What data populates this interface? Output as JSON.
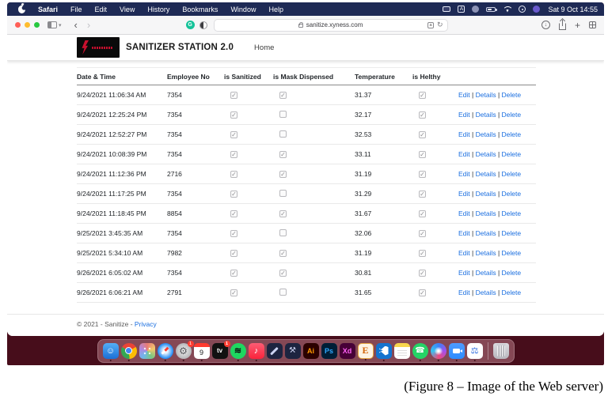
{
  "colors": {
    "menubar": "#1e2a55",
    "wallpaper": "#470d1b",
    "link": "#1b6fe0",
    "brand_red": "#c8102e",
    "badge_red": "#ff3b30"
  },
  "menu_bar": {
    "items": [
      "Safari",
      "File",
      "Edit",
      "View",
      "History",
      "Bookmarks",
      "Window",
      "Help"
    ],
    "status_icons": [
      {
        "key": "screen-mirroring"
      },
      {
        "key": "input-source",
        "glyph": "A"
      },
      {
        "key": "status-circle"
      },
      {
        "key": "battery"
      },
      {
        "key": "wifi"
      },
      {
        "key": "control-center"
      },
      {
        "key": "purple-dot"
      }
    ],
    "clock": "Sat 9 Oct 14:55"
  },
  "browser": {
    "url": "sanitize.xyness.com"
  },
  "site": {
    "title": "SANITIZER STATION 2.0",
    "nav_home": "Home",
    "footer_copyright": "© 2021 - Sanitize -",
    "footer_privacy": "Privacy"
  },
  "table": {
    "columns": [
      "Date & Time",
      "Employee No",
      "is Sanitized",
      "is Mask Dispensed",
      "Temperature",
      "is Helthy"
    ],
    "actions": {
      "edit": "Edit",
      "details": "Details",
      "delete": "Delete",
      "separator": " | "
    },
    "rows": [
      {
        "datetime": "9/24/2021 11:06:34 AM",
        "employee_no": "7354",
        "is_sanitized": true,
        "is_mask_dispensed": true,
        "temperature": "31.37",
        "is_healthy": true
      },
      {
        "datetime": "9/24/2021 12:25:24 PM",
        "employee_no": "7354",
        "is_sanitized": true,
        "is_mask_dispensed": false,
        "temperature": "32.17",
        "is_healthy": true
      },
      {
        "datetime": "9/24/2021 12:52:27 PM",
        "employee_no": "7354",
        "is_sanitized": true,
        "is_mask_dispensed": false,
        "temperature": "32.53",
        "is_healthy": true
      },
      {
        "datetime": "9/24/2021 10:08:39 PM",
        "employee_no": "7354",
        "is_sanitized": true,
        "is_mask_dispensed": true,
        "temperature": "33.11",
        "is_healthy": true
      },
      {
        "datetime": "9/24/2021 11:12:36 PM",
        "employee_no": "2716",
        "is_sanitized": true,
        "is_mask_dispensed": true,
        "temperature": "31.19",
        "is_healthy": true
      },
      {
        "datetime": "9/24/2021 11:17:25 PM",
        "employee_no": "7354",
        "is_sanitized": true,
        "is_mask_dispensed": false,
        "temperature": "31.29",
        "is_healthy": true
      },
      {
        "datetime": "9/24/2021 11:18:45 PM",
        "employee_no": "8854",
        "is_sanitized": true,
        "is_mask_dispensed": true,
        "temperature": "31.67",
        "is_healthy": true
      },
      {
        "datetime": "9/25/2021 3:45:35 AM",
        "employee_no": "7354",
        "is_sanitized": true,
        "is_mask_dispensed": false,
        "temperature": "32.06",
        "is_healthy": true
      },
      {
        "datetime": "9/25/2021 5:34:10 AM",
        "employee_no": "7982",
        "is_sanitized": true,
        "is_mask_dispensed": true,
        "temperature": "31.19",
        "is_healthy": true
      },
      {
        "datetime": "9/26/2021 6:05:02 AM",
        "employee_no": "7354",
        "is_sanitized": true,
        "is_mask_dispensed": true,
        "temperature": "30.81",
        "is_healthy": true
      },
      {
        "datetime": "9/26/2021 6:06:21 AM",
        "employee_no": "2791",
        "is_sanitized": true,
        "is_mask_dispensed": false,
        "temperature": "31.65",
        "is_healthy": true
      }
    ]
  },
  "dock": {
    "items": [
      {
        "key": "finder",
        "glyph": "☺",
        "running": true
      },
      {
        "key": "chrome",
        "running": true
      },
      {
        "key": "launchpad"
      },
      {
        "key": "safari",
        "running": true
      },
      {
        "key": "system-preferences",
        "glyph": "⚙",
        "badge": "1",
        "running": true
      },
      {
        "key": "calendar",
        "glyph": "9",
        "running": true
      },
      {
        "key": "apple-tv",
        "glyph": "tv",
        "badge": "1"
      },
      {
        "key": "spotify",
        "glyph": "≋",
        "running": true
      },
      {
        "key": "apple-music",
        "glyph": "♪",
        "running": true
      },
      {
        "key": "dark-tool"
      },
      {
        "key": "hammer-tool",
        "glyph": "⚒"
      },
      {
        "key": "illustrator",
        "glyph": "Ai"
      },
      {
        "key": "photoshop",
        "glyph": "Ps"
      },
      {
        "key": "adobe-xd",
        "glyph": "Xd"
      },
      {
        "key": "e-letter",
        "glyph": "E",
        "running": true
      },
      {
        "key": "vscode",
        "running": true
      },
      {
        "key": "notes"
      },
      {
        "key": "whatsapp",
        "glyph": "☎",
        "running": true
      },
      {
        "key": "siri-sphere",
        "running": true
      },
      {
        "key": "zoom",
        "running": true
      },
      {
        "key": "scale",
        "glyph": "⚖",
        "running": true
      },
      {
        "key": "trash",
        "separator_before": true
      }
    ]
  },
  "caption": "(Figure 8 – Image of the Web server)"
}
